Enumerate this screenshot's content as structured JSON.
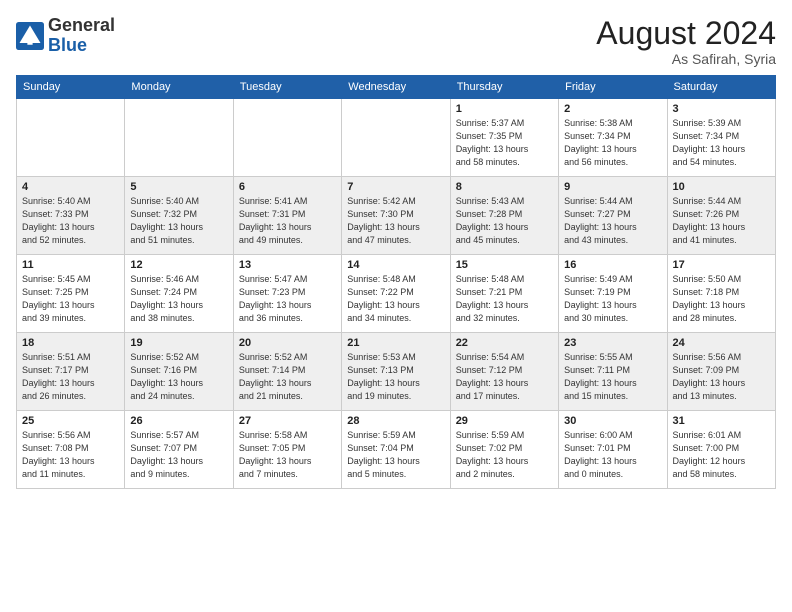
{
  "header": {
    "logo_general": "General",
    "logo_blue": "Blue",
    "month_year": "August 2024",
    "location": "As Safirah, Syria"
  },
  "weekdays": [
    "Sunday",
    "Monday",
    "Tuesday",
    "Wednesday",
    "Thursday",
    "Friday",
    "Saturday"
  ],
  "weeks": [
    [
      {
        "day": "",
        "info": ""
      },
      {
        "day": "",
        "info": ""
      },
      {
        "day": "",
        "info": ""
      },
      {
        "day": "",
        "info": ""
      },
      {
        "day": "1",
        "info": "Sunrise: 5:37 AM\nSunset: 7:35 PM\nDaylight: 13 hours\nand 58 minutes."
      },
      {
        "day": "2",
        "info": "Sunrise: 5:38 AM\nSunset: 7:34 PM\nDaylight: 13 hours\nand 56 minutes."
      },
      {
        "day": "3",
        "info": "Sunrise: 5:39 AM\nSunset: 7:34 PM\nDaylight: 13 hours\nand 54 minutes."
      }
    ],
    [
      {
        "day": "4",
        "info": "Sunrise: 5:40 AM\nSunset: 7:33 PM\nDaylight: 13 hours\nand 52 minutes."
      },
      {
        "day": "5",
        "info": "Sunrise: 5:40 AM\nSunset: 7:32 PM\nDaylight: 13 hours\nand 51 minutes."
      },
      {
        "day": "6",
        "info": "Sunrise: 5:41 AM\nSunset: 7:31 PM\nDaylight: 13 hours\nand 49 minutes."
      },
      {
        "day": "7",
        "info": "Sunrise: 5:42 AM\nSunset: 7:30 PM\nDaylight: 13 hours\nand 47 minutes."
      },
      {
        "day": "8",
        "info": "Sunrise: 5:43 AM\nSunset: 7:28 PM\nDaylight: 13 hours\nand 45 minutes."
      },
      {
        "day": "9",
        "info": "Sunrise: 5:44 AM\nSunset: 7:27 PM\nDaylight: 13 hours\nand 43 minutes."
      },
      {
        "day": "10",
        "info": "Sunrise: 5:44 AM\nSunset: 7:26 PM\nDaylight: 13 hours\nand 41 minutes."
      }
    ],
    [
      {
        "day": "11",
        "info": "Sunrise: 5:45 AM\nSunset: 7:25 PM\nDaylight: 13 hours\nand 39 minutes."
      },
      {
        "day": "12",
        "info": "Sunrise: 5:46 AM\nSunset: 7:24 PM\nDaylight: 13 hours\nand 38 minutes."
      },
      {
        "day": "13",
        "info": "Sunrise: 5:47 AM\nSunset: 7:23 PM\nDaylight: 13 hours\nand 36 minutes."
      },
      {
        "day": "14",
        "info": "Sunrise: 5:48 AM\nSunset: 7:22 PM\nDaylight: 13 hours\nand 34 minutes."
      },
      {
        "day": "15",
        "info": "Sunrise: 5:48 AM\nSunset: 7:21 PM\nDaylight: 13 hours\nand 32 minutes."
      },
      {
        "day": "16",
        "info": "Sunrise: 5:49 AM\nSunset: 7:19 PM\nDaylight: 13 hours\nand 30 minutes."
      },
      {
        "day": "17",
        "info": "Sunrise: 5:50 AM\nSunset: 7:18 PM\nDaylight: 13 hours\nand 28 minutes."
      }
    ],
    [
      {
        "day": "18",
        "info": "Sunrise: 5:51 AM\nSunset: 7:17 PM\nDaylight: 13 hours\nand 26 minutes."
      },
      {
        "day": "19",
        "info": "Sunrise: 5:52 AM\nSunset: 7:16 PM\nDaylight: 13 hours\nand 24 minutes."
      },
      {
        "day": "20",
        "info": "Sunrise: 5:52 AM\nSunset: 7:14 PM\nDaylight: 13 hours\nand 21 minutes."
      },
      {
        "day": "21",
        "info": "Sunrise: 5:53 AM\nSunset: 7:13 PM\nDaylight: 13 hours\nand 19 minutes."
      },
      {
        "day": "22",
        "info": "Sunrise: 5:54 AM\nSunset: 7:12 PM\nDaylight: 13 hours\nand 17 minutes."
      },
      {
        "day": "23",
        "info": "Sunrise: 5:55 AM\nSunset: 7:11 PM\nDaylight: 13 hours\nand 15 minutes."
      },
      {
        "day": "24",
        "info": "Sunrise: 5:56 AM\nSunset: 7:09 PM\nDaylight: 13 hours\nand 13 minutes."
      }
    ],
    [
      {
        "day": "25",
        "info": "Sunrise: 5:56 AM\nSunset: 7:08 PM\nDaylight: 13 hours\nand 11 minutes."
      },
      {
        "day": "26",
        "info": "Sunrise: 5:57 AM\nSunset: 7:07 PM\nDaylight: 13 hours\nand 9 minutes."
      },
      {
        "day": "27",
        "info": "Sunrise: 5:58 AM\nSunset: 7:05 PM\nDaylight: 13 hours\nand 7 minutes."
      },
      {
        "day": "28",
        "info": "Sunrise: 5:59 AM\nSunset: 7:04 PM\nDaylight: 13 hours\nand 5 minutes."
      },
      {
        "day": "29",
        "info": "Sunrise: 5:59 AM\nSunset: 7:02 PM\nDaylight: 13 hours\nand 2 minutes."
      },
      {
        "day": "30",
        "info": "Sunrise: 6:00 AM\nSunset: 7:01 PM\nDaylight: 13 hours\nand 0 minutes."
      },
      {
        "day": "31",
        "info": "Sunrise: 6:01 AM\nSunset: 7:00 PM\nDaylight: 12 hours\nand 58 minutes."
      }
    ]
  ]
}
